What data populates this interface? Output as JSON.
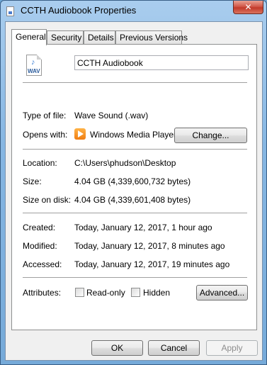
{
  "window": {
    "title": "CCTH Audiobook Properties",
    "close_glyph": "✕"
  },
  "tabs": [
    {
      "label": "General",
      "active": true
    },
    {
      "label": "Security",
      "active": false
    },
    {
      "label": "Details",
      "active": false
    },
    {
      "label": "Previous Versions",
      "active": false
    }
  ],
  "file": {
    "icon_label": "WAV",
    "icon_note": "♪",
    "name": "CCTH Audiobook"
  },
  "props": {
    "type_label": "Type of file:",
    "type_value": "Wave Sound (.wav)",
    "opens_label": "Opens with:",
    "opens_value": "Windows Media Player",
    "change_button": "Change...",
    "location_label": "Location:",
    "location_value": "C:\\Users\\phudson\\Desktop",
    "size_label": "Size:",
    "size_value": "4.04 GB (4,339,600,732 bytes)",
    "size_disk_label": "Size on disk:",
    "size_disk_value": "4.04 GB (4,339,601,408 bytes)",
    "created_label": "Created:",
    "created_value": "Today, January 12, 2017, 1 hour ago",
    "modified_label": "Modified:",
    "modified_value": "Today, January 12, 2017, 8 minutes ago",
    "accessed_label": "Accessed:",
    "accessed_value": "Today, January 12, 2017, 19 minutes ago",
    "attributes_label": "Attributes:",
    "readonly_label": "Read-only",
    "hidden_label": "Hidden",
    "advanced_button": "Advanced..."
  },
  "footer": {
    "ok": "OK",
    "cancel": "Cancel",
    "apply": "Apply"
  }
}
